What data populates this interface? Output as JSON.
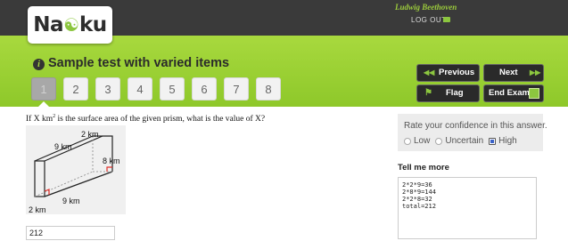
{
  "app": {
    "logo_text_left": "Na",
    "logo_text_right": "ku"
  },
  "user": {
    "name": "Ludwig Beethoven",
    "logout_label": "LOG OUT"
  },
  "test": {
    "title": "Sample test with varied items"
  },
  "question_nav": [
    "1",
    "2",
    "3",
    "4",
    "5",
    "6",
    "7",
    "8"
  ],
  "current_question": "1",
  "controls": {
    "previous_label": "Previous",
    "next_label": "Next",
    "flag_label": "Flag",
    "end_label": "End Exam"
  },
  "question": {
    "text_before": "If X km",
    "superscript": "2",
    "text_after": " is the surface area of the given prism, what is the value of X?",
    "figure_labels": {
      "top": "2 km",
      "top_left": "9 km",
      "right": "8 km",
      "bottom": "9 km",
      "bottom_left": "2 km"
    },
    "answer_value": "212"
  },
  "confidence": {
    "title": "Rate your confidence in this answer.",
    "options": [
      "Low",
      "Uncertain",
      "High"
    ],
    "selected": "High"
  },
  "tell_more": {
    "title": "Tell me more",
    "text": "2*2*9=36\n2*8*9=144\n2*2*8=32\ntotal=212"
  },
  "colors": {
    "accent_green": "#8cc63f",
    "dark_bar": "#3a3a3a"
  }
}
